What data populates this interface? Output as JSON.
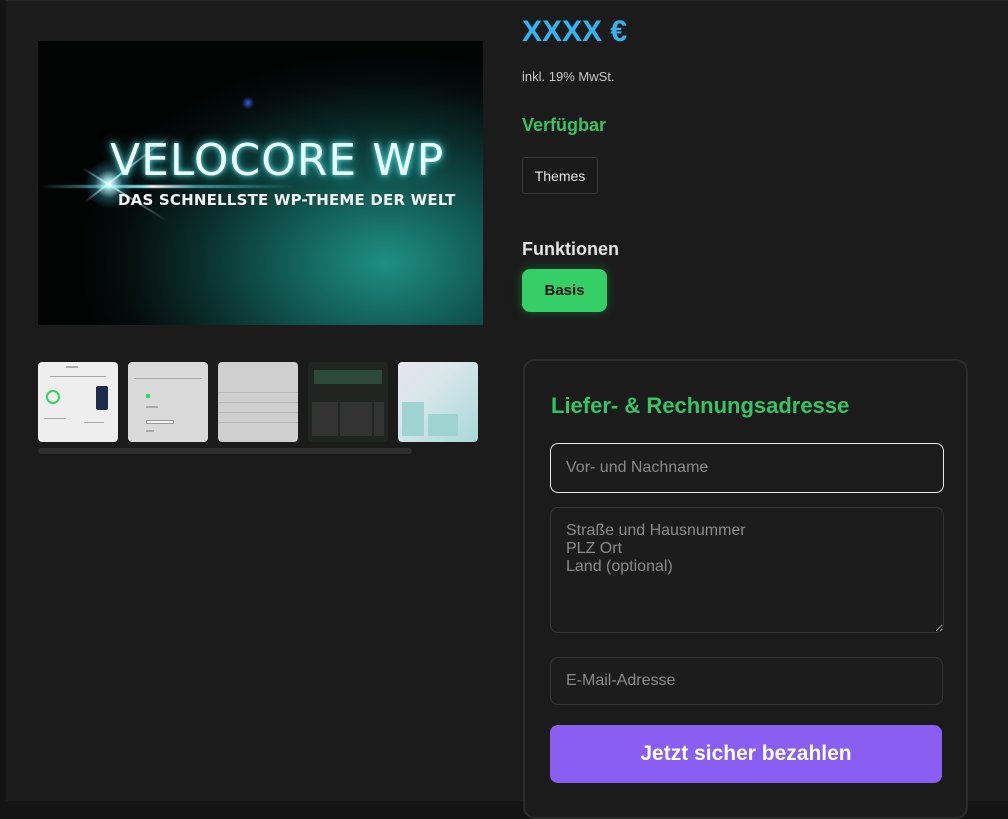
{
  "product": {
    "hero_title": "VELOCORE WP",
    "hero_subtitle": "DAS SCHNELLSTE WP-THEME DER WELT",
    "price": "XXXX €",
    "vat_note": "inkl. 19% MwSt.",
    "availability": "Verfügbar",
    "category": "Themes",
    "functions_heading": "Funktionen",
    "feature_option": "Basis"
  },
  "checkout": {
    "card_title": "Liefer- & Rechnungsadresse",
    "name_placeholder": "Vor- und Nachname",
    "address_placeholder": "Straße und Hausnummer\nPLZ Ort\nLand (optional)",
    "email_placeholder": "E-Mail-Adresse",
    "pay_button": "Jetzt sicher bezahlen"
  },
  "colors": {
    "price": "#2fb6f0",
    "available": "#35c463",
    "feature_button": "#35cf68",
    "pay_button": "#8b5ef2"
  }
}
